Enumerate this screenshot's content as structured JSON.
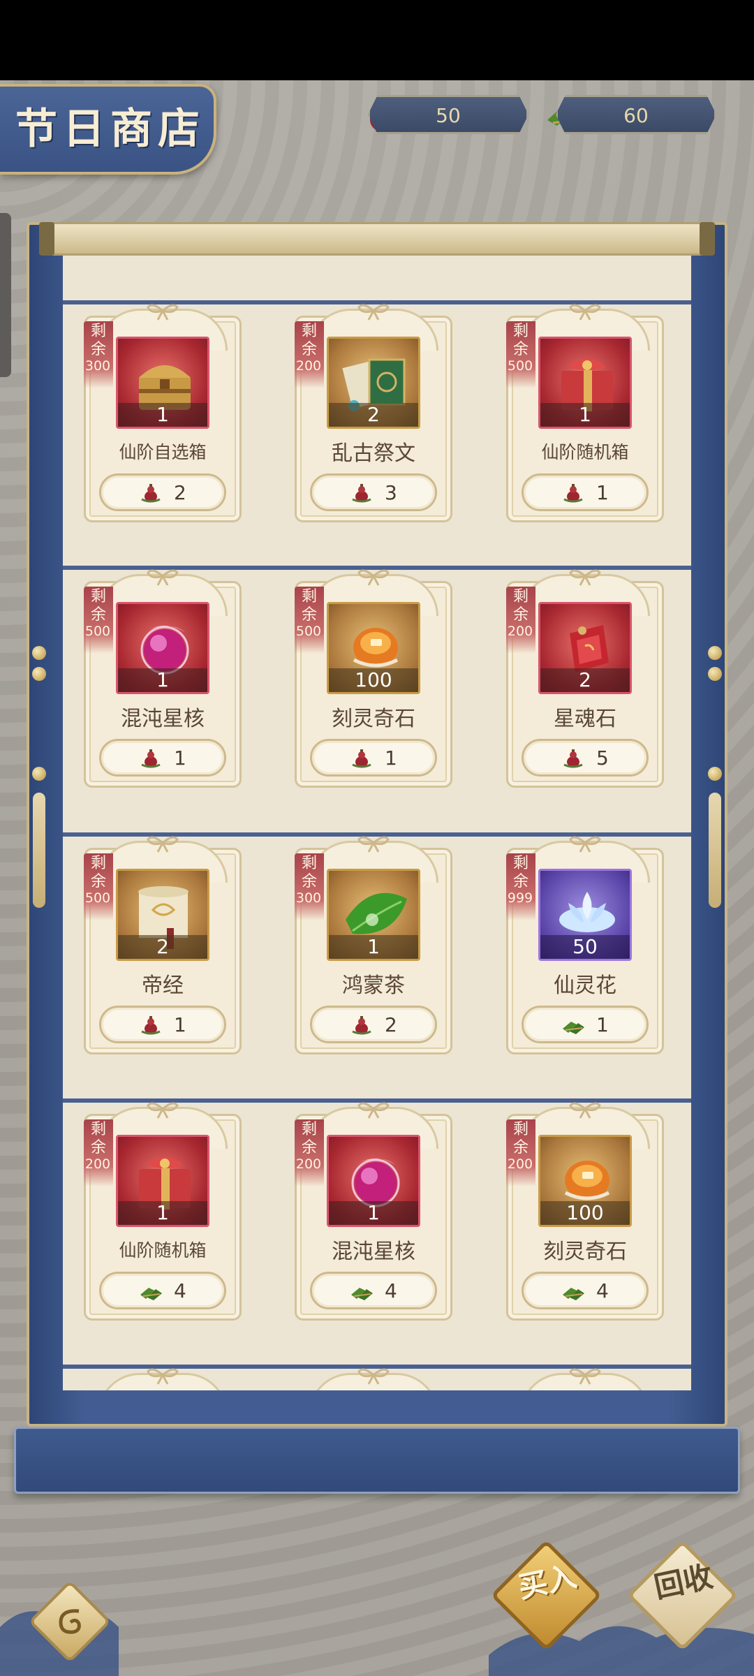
{
  "header": {
    "title": "节日商店",
    "currencies": [
      {
        "icon": "red-gourd-icon",
        "value": "50"
      },
      {
        "icon": "green-zongzi-icon",
        "value": "60"
      }
    ]
  },
  "shop": {
    "remain_label": "剩余",
    "items": [
      {
        "name": "仙阶自选箱",
        "remain": "300",
        "qty": "1",
        "price": "2",
        "price_icon": "red-gourd-icon",
        "frame": "red",
        "art": "chest-icon"
      },
      {
        "name": "乱古祭文",
        "remain": "200",
        "qty": "2",
        "price": "3",
        "price_icon": "red-gourd-icon",
        "frame": "gold",
        "art": "book-icon"
      },
      {
        "name": "仙阶随机箱",
        "remain": "500",
        "qty": "1",
        "price": "1",
        "price_icon": "red-gourd-icon",
        "frame": "red",
        "art": "gift-box-icon"
      },
      {
        "name": "混沌星核",
        "remain": "500",
        "qty": "1",
        "price": "1",
        "price_icon": "red-gourd-icon",
        "frame": "red",
        "art": "orb-icon"
      },
      {
        "name": "刻灵奇石",
        "remain": "500",
        "qty": "100",
        "price": "1",
        "price_icon": "red-gourd-icon",
        "frame": "gold",
        "art": "amber-stone-icon"
      },
      {
        "name": "星魂石",
        "remain": "200",
        "qty": "2",
        "price": "5",
        "price_icon": "red-gourd-icon",
        "frame": "red",
        "art": "red-stone-icon"
      },
      {
        "name": "帝经",
        "remain": "500",
        "qty": "2",
        "price": "1",
        "price_icon": "red-gourd-icon",
        "frame": "gold",
        "art": "scroll-icon"
      },
      {
        "name": "鸿蒙茶",
        "remain": "300",
        "qty": "1",
        "price": "2",
        "price_icon": "red-gourd-icon",
        "frame": "gold",
        "art": "tea-leaf-icon"
      },
      {
        "name": "仙灵花",
        "remain": "999",
        "qty": "50",
        "price": "1",
        "price_icon": "green-zongzi-icon",
        "frame": "purple",
        "art": "lotus-icon"
      },
      {
        "name": "仙阶随机箱",
        "remain": "200",
        "qty": "1",
        "price": "4",
        "price_icon": "green-zongzi-icon",
        "frame": "red",
        "art": "gift-box-icon"
      },
      {
        "name": "混沌星核",
        "remain": "200",
        "qty": "1",
        "price": "4",
        "price_icon": "green-zongzi-icon",
        "frame": "red",
        "art": "orb-icon"
      },
      {
        "name": "刻灵奇石",
        "remain": "200",
        "qty": "100",
        "price": "4",
        "price_icon": "green-zongzi-icon",
        "frame": "gold",
        "art": "amber-stone-icon"
      }
    ]
  },
  "buttons": {
    "buy": "买入",
    "recycle": "回收",
    "back_icon": "back-ornament-icon"
  }
}
